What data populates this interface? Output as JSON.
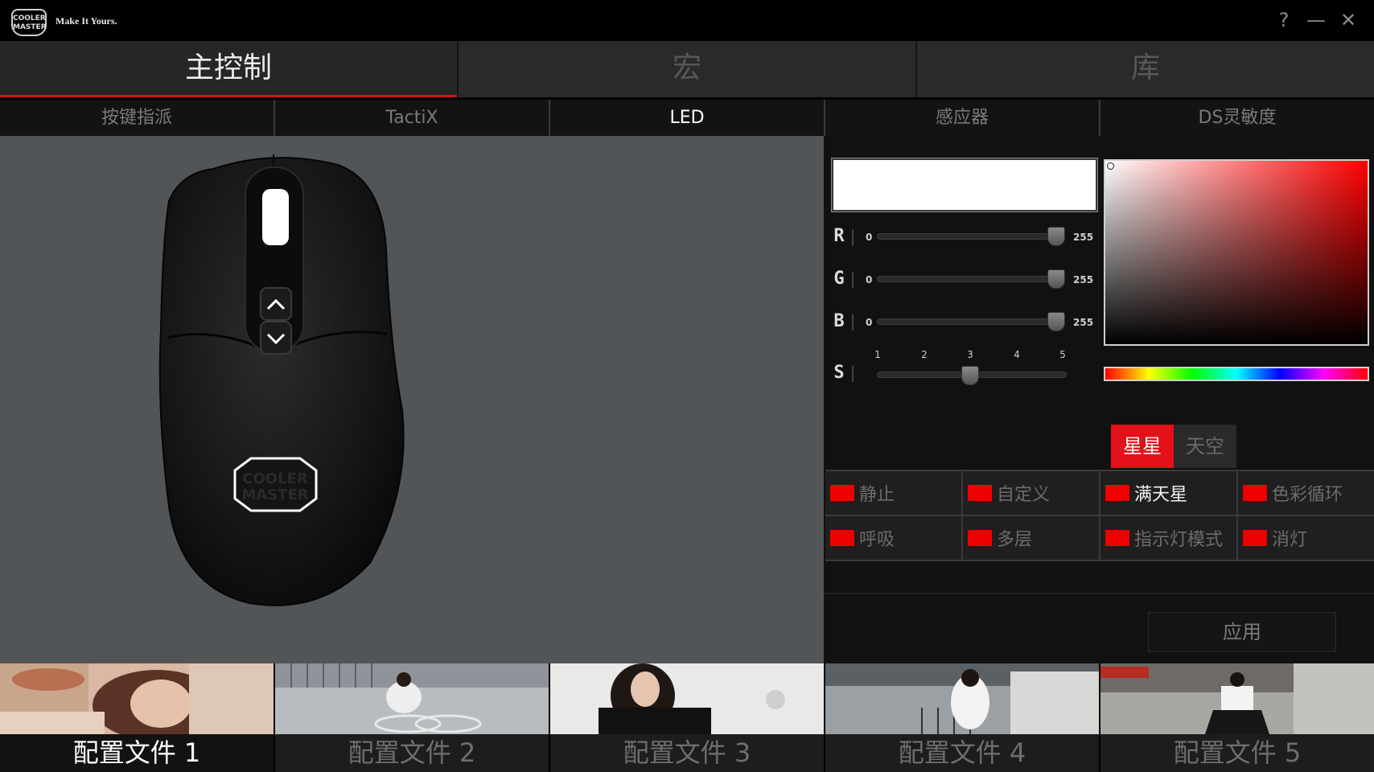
{
  "titlebar": {
    "logo_line1": "COOLER",
    "logo_line2": "MASTER",
    "tagline": "Make It Yours.",
    "help": "?",
    "minimize": "—",
    "close": "✕"
  },
  "main_tabs": [
    {
      "label": "主控制",
      "active": true
    },
    {
      "label": "宏",
      "active": false
    },
    {
      "label": "库",
      "active": false
    }
  ],
  "sub_tabs": [
    {
      "label": "按键指派",
      "active": false
    },
    {
      "label": "TactiX",
      "active": false
    },
    {
      "label": "LED",
      "active": true
    },
    {
      "label": "感应器",
      "active": false
    },
    {
      "label": "DS灵敏度",
      "active": false
    }
  ],
  "led": {
    "current_color": "#ffffff",
    "sliders": [
      {
        "label": "R",
        "min": "0",
        "max": "255",
        "value": 255
      },
      {
        "label": "G",
        "min": "0",
        "max": "255",
        "value": 255
      },
      {
        "label": "B",
        "min": "0",
        "max": "255",
        "value": 255
      }
    ],
    "speed": {
      "label": "S",
      "ticks": [
        "1",
        "2",
        "3",
        "4",
        "5"
      ],
      "value": 3
    },
    "variant_tabs": [
      {
        "label": "星星",
        "active": true
      },
      {
        "label": "天空",
        "active": false
      }
    ],
    "effects": [
      {
        "label": "静止",
        "active": false
      },
      {
        "label": "自定义",
        "active": false
      },
      {
        "label": "满天星",
        "active": true
      },
      {
        "label": "色彩循环",
        "active": false
      },
      {
        "label": "呼吸",
        "active": false
      },
      {
        "label": "多层",
        "active": false
      },
      {
        "label": "指示灯模式",
        "active": false
      },
      {
        "label": "消灯",
        "active": false
      }
    ],
    "apply_label": "应用"
  },
  "profiles": [
    {
      "label": "配置文件 1",
      "active": true
    },
    {
      "label": "配置文件 2",
      "active": false
    },
    {
      "label": "配置文件 3",
      "active": false
    },
    {
      "label": "配置文件 4",
      "active": false
    },
    {
      "label": "配置文件 5",
      "active": false
    }
  ],
  "colors": {
    "accent_red": "#e4101a",
    "effect_indicator": "#ee0000"
  }
}
